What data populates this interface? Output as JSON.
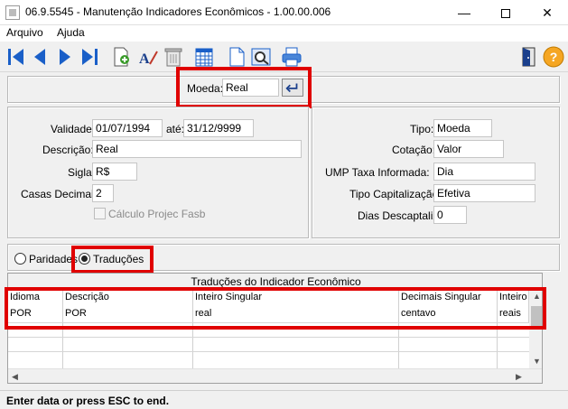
{
  "window": {
    "title": "06.9.5545 - Manutenção Indicadores Econômicos - 1.00.00.006",
    "minimize_glyph": "—",
    "close_glyph": "✕"
  },
  "menu": [
    "Arquivo",
    "Ajuda"
  ],
  "toolbar_icons": [
    "first-icon",
    "previous-icon",
    "next-icon",
    "last-icon",
    "new-record-icon",
    "edit-icon",
    "delete-icon",
    "calendar-icon",
    "document-icon",
    "preview-icon",
    "print-icon",
    "exit-icon",
    "help-icon"
  ],
  "moeda": {
    "label": "Moeda:",
    "value": "Real"
  },
  "left": {
    "validade_label": "Validade:",
    "validade_from": "01/07/1994",
    "ate_label": "até:",
    "validade_to": "31/12/9999",
    "descricao_label": "Descrição:",
    "descricao": "Real",
    "sigla_label": "Sigla:",
    "sigla": "R$",
    "casas_label": "Casas Decimais:",
    "casas": "2",
    "calculo_label": "Cálculo Projec Fasb"
  },
  "right": {
    "tipo_label": "Tipo:",
    "tipo": "Moeda",
    "cotacao_label": "Cotação:",
    "cotacao": "Valor",
    "ump_label": "UMP Taxa Informada:",
    "ump": "Dia",
    "capitalizacao_label": "Tipo Capitalização:",
    "capitalizacao": "Efetiva",
    "dias_label": "Dias Descaptaliz:",
    "dias": "0"
  },
  "radios": {
    "paridades": "Paridades",
    "traducoes": "Traduções",
    "selected": "traducoes"
  },
  "grid": {
    "title": "Traduções do Indicador Econômico",
    "columns": [
      "Idioma",
      "Descrição",
      "Inteiro Singular",
      "Decimais Singular",
      "Inteiro"
    ],
    "rows": [
      [
        "POR",
        "POR",
        "real",
        "centavo",
        "reais"
      ]
    ]
  },
  "status": "Enter data or press ESC to end.",
  "colors": {
    "highlight": "#e00000",
    "toolbar_blue": "#1a5fc8"
  }
}
